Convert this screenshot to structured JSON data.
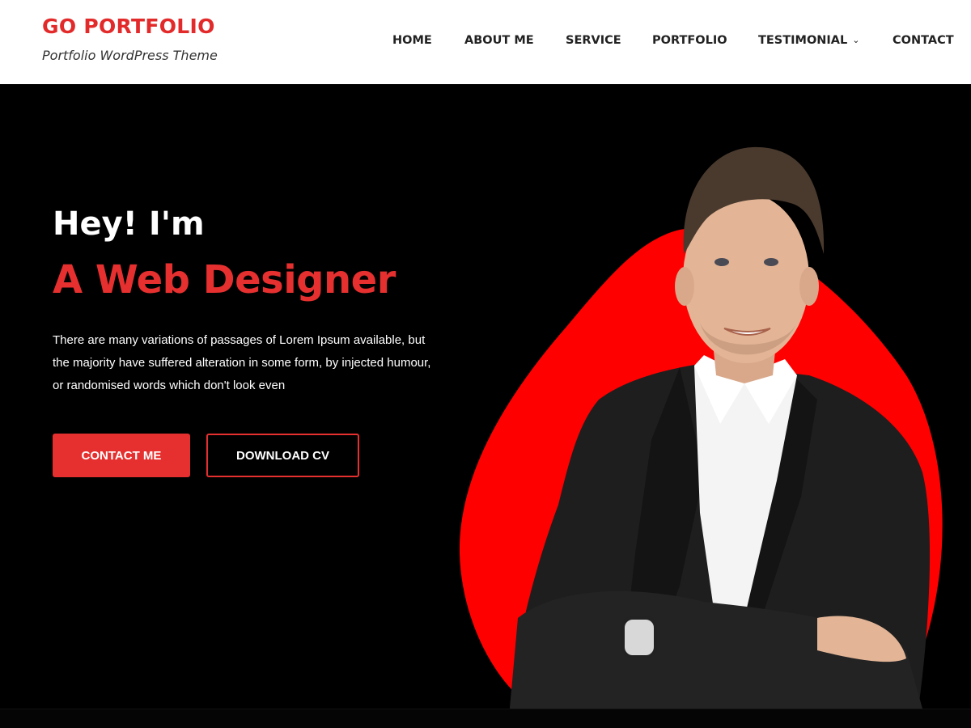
{
  "brand": {
    "title": "GO PORTFOLIO",
    "tagline": "Portfolio WordPress Theme"
  },
  "nav": {
    "items": [
      {
        "label": "HOME"
      },
      {
        "label": "ABOUT ME"
      },
      {
        "label": "SERVICE"
      },
      {
        "label": "PORTFOLIO"
      },
      {
        "label": "TESTIMONIAL",
        "has_dropdown": true
      },
      {
        "label": "CONTACT"
      }
    ],
    "dropdown_icon": "chevron-down-icon"
  },
  "hero": {
    "greeting": "Hey! I'm",
    "role": "A Web Designer",
    "description": "There are many variations of passages of Lorem Ipsum available, but the majority have suffered alteration in some form, by injected humour, or randomised words which don't look even",
    "primary_button": "CONTACT ME",
    "secondary_button": "DOWNLOAD CV",
    "image": "portrait-of-man-in-suit-with-red-blob"
  },
  "colors": {
    "accent": "#e5302f",
    "brand": "#e32a2a",
    "hero_background": "#000000",
    "header_background": "#ffffff",
    "blob": "#ff0000"
  }
}
